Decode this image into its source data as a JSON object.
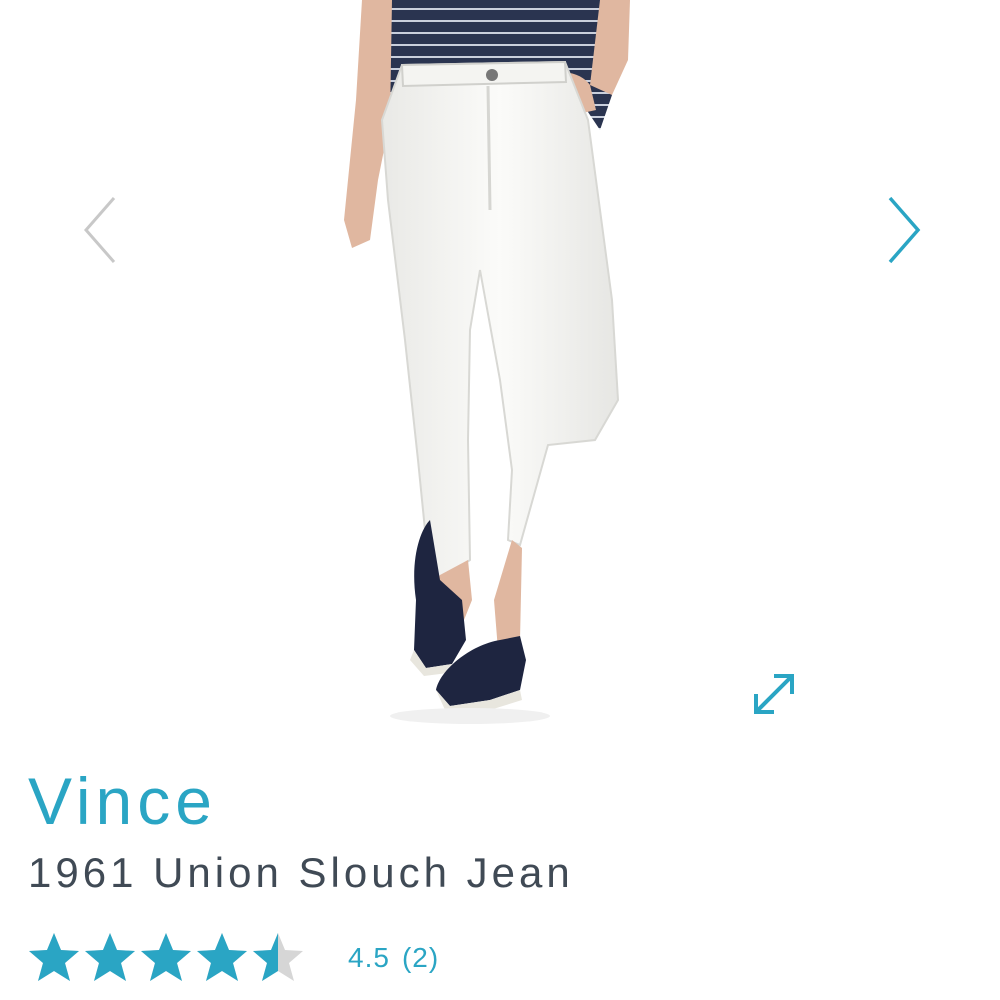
{
  "product": {
    "brand": "Vince",
    "name": "1961 Union Slouch Jean",
    "rating": 4.5,
    "rating_value_label": "4.5",
    "review_count_label": "(2)",
    "stars_total": 5
  },
  "gallery": {
    "prev_icon": "chevron-left-icon",
    "next_icon": "chevron-right-icon",
    "expand_icon": "expand-arrows-icon"
  },
  "colors": {
    "accent": "#2aa5c4",
    "text_dark": "#404a55",
    "star_empty": "#d6d6d6",
    "arrow_disabled": "#c8c8c8"
  }
}
